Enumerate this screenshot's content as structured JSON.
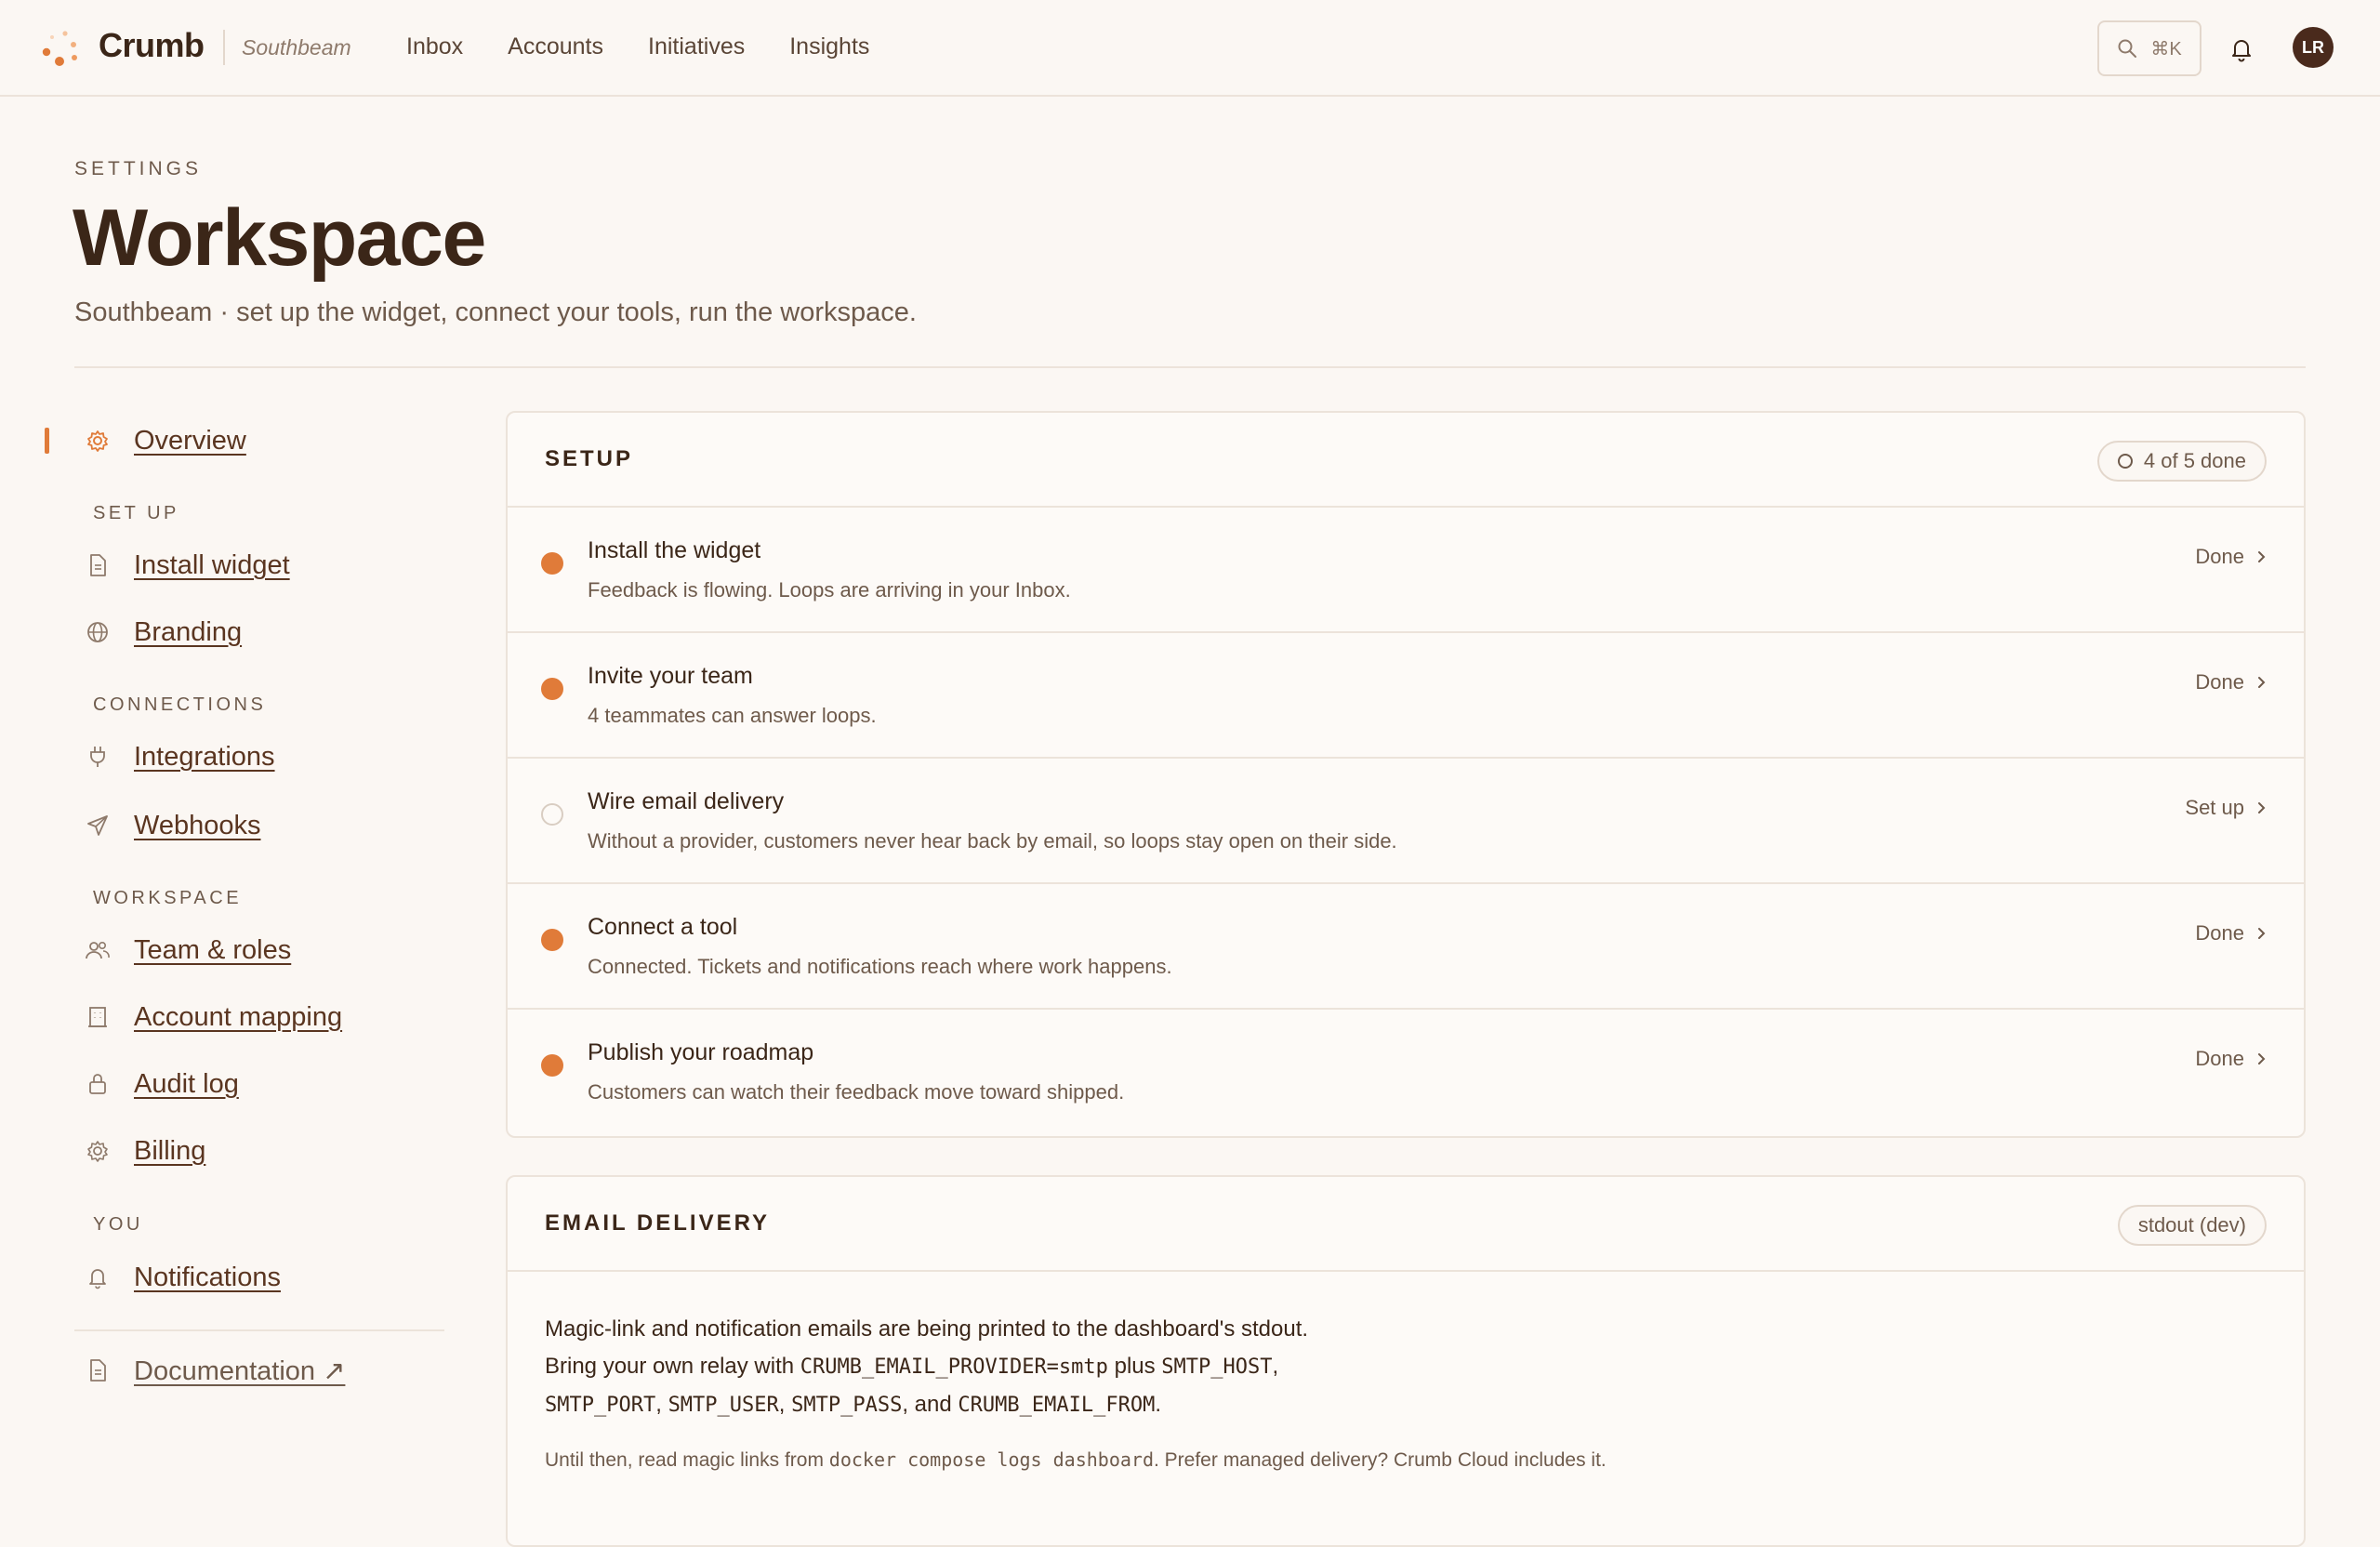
{
  "app": {
    "brand": "Crumb",
    "workspace": "Southbeam",
    "nav": [
      "Inbox",
      "Accounts",
      "Initiatives",
      "Insights"
    ],
    "search_shortcut": "⌘K",
    "avatar_initials": "LR",
    "accent_color": "#e07b39"
  },
  "header": {
    "eyebrow": "SETTINGS",
    "title": "Workspace",
    "subtitle": "Southbeam · set up the widget, connect your tools, run the workspace."
  },
  "sidebar": {
    "overview": {
      "label": "Overview",
      "icon": "gear-icon",
      "active": true
    },
    "groups": [
      {
        "heading": "SET UP",
        "items": [
          {
            "label": "Install widget",
            "icon": "document-icon"
          },
          {
            "label": "Branding",
            "icon": "globe-icon"
          }
        ]
      },
      {
        "heading": "CONNECTIONS",
        "items": [
          {
            "label": "Integrations",
            "icon": "plug-icon"
          },
          {
            "label": "Webhooks",
            "icon": "send-icon"
          }
        ]
      },
      {
        "heading": "WORKSPACE",
        "items": [
          {
            "label": "Team & roles",
            "icon": "users-icon"
          },
          {
            "label": "Account mapping",
            "icon": "building-icon"
          },
          {
            "label": "Audit log",
            "icon": "lock-icon"
          },
          {
            "label": "Billing",
            "icon": "gear-icon"
          }
        ]
      },
      {
        "heading": "YOU",
        "items": [
          {
            "label": "Notifications",
            "icon": "bell-icon"
          }
        ]
      }
    ],
    "documentation": {
      "label": "Documentation ↗",
      "icon": "document-icon"
    }
  },
  "setup": {
    "title": "SETUP",
    "progress": "4 of 5 done",
    "steps": [
      {
        "title": "Install the widget",
        "desc": "Feedback is flowing. Loops are arriving in your Inbox.",
        "action": "Done",
        "done": true
      },
      {
        "title": "Invite your team",
        "desc": "4 teammates can answer loops.",
        "action": "Done",
        "done": true
      },
      {
        "title": "Wire email delivery",
        "desc": "Without a provider, customers never hear back by email, so loops stay open on their side.",
        "action": "Set up",
        "done": false
      },
      {
        "title": "Connect a tool",
        "desc": "Connected. Tickets and notifications reach where work happens.",
        "action": "Done",
        "done": true
      },
      {
        "title": "Publish your roadmap",
        "desc": "Customers can watch their feedback move toward shipped.",
        "action": "Done",
        "done": true
      }
    ]
  },
  "email": {
    "title": "EMAIL DELIVERY",
    "badge": "stdout (dev)",
    "p1_a": "Magic-link and notification emails are being printed to the dashboard's stdout.",
    "p1_b": "Bring your own relay with ",
    "code_provider": "CRUMB_EMAIL_PROVIDER=smtp",
    "p1_c": " plus ",
    "code_host": "SMTP_HOST",
    "sep": ",",
    "code_port": "SMTP_PORT",
    "code_user": "SMTP_USER",
    "code_pass": "SMTP_PASS",
    "p1_and": ", and ",
    "code_from": "CRUMB_EMAIL_FROM",
    "p1_end": ".",
    "p2_a": "Until then, read magic links from ",
    "code_logs": "docker compose logs dashboard",
    "p2_b": ". Prefer managed delivery? Crumb Cloud includes it."
  }
}
